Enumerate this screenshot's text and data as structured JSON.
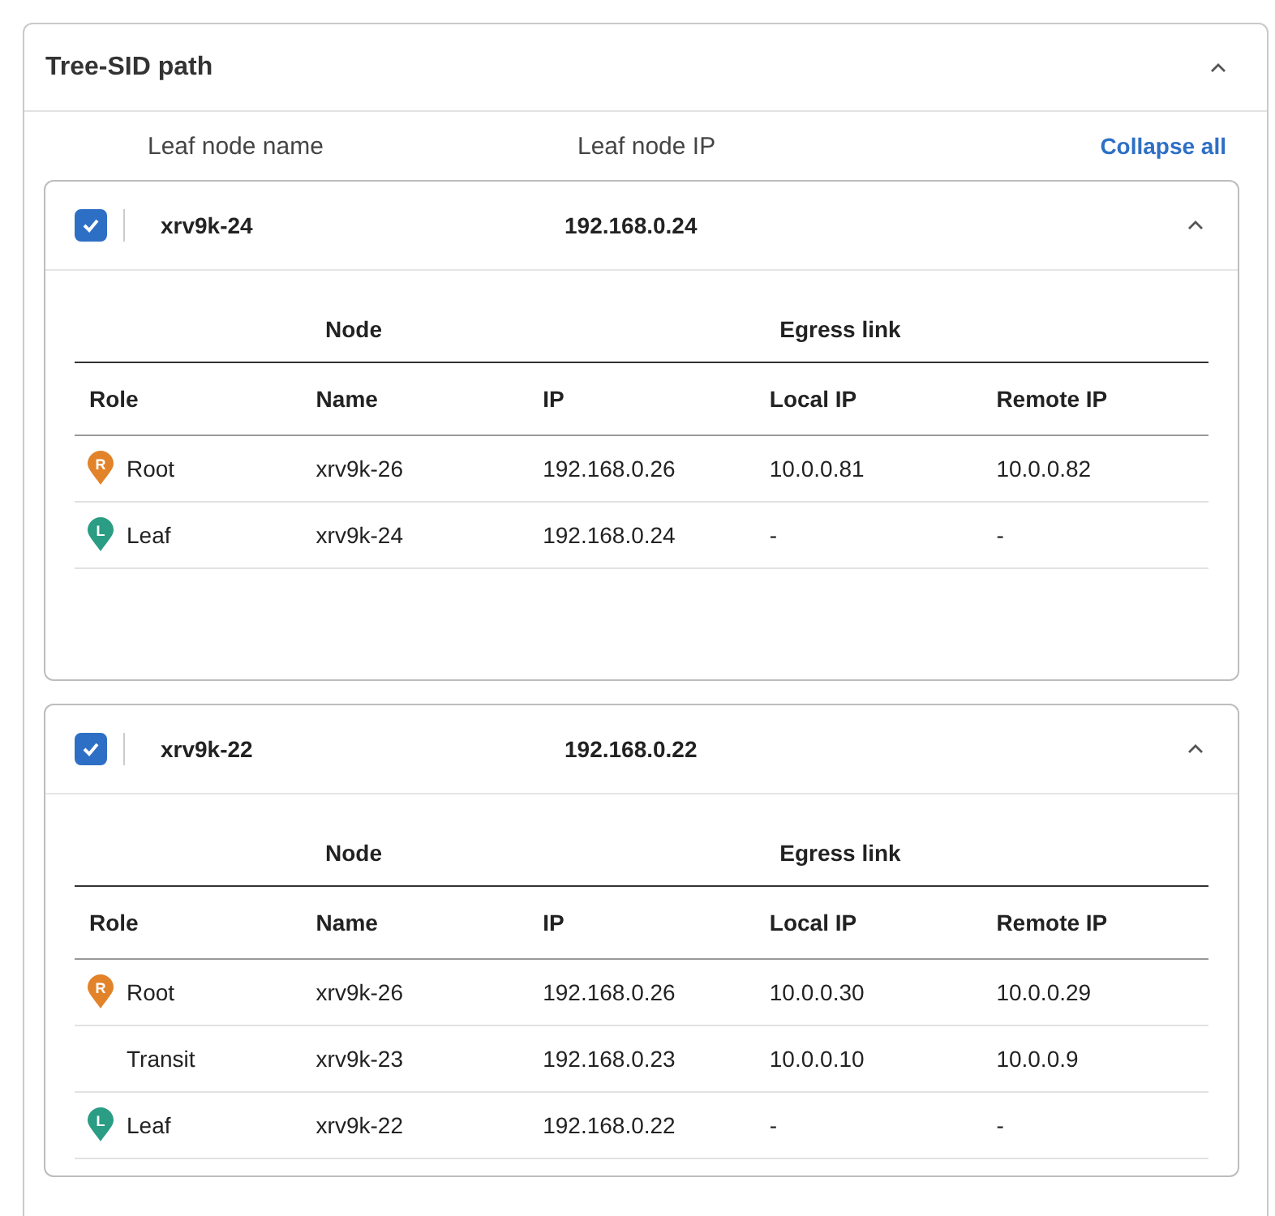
{
  "panel": {
    "title": "Tree-SID path",
    "expanded": true
  },
  "list_header": {
    "name_label": "Leaf node name",
    "ip_label": "Leaf node IP",
    "collapse_link": "Collapse all"
  },
  "leaves": [
    {
      "name": "xrv9k-24",
      "ip": "192.168.0.24",
      "checked": true,
      "expanded": true,
      "group_headers": [
        "Node",
        "Egress link"
      ],
      "columns": [
        "Role",
        "Name",
        "IP",
        "Local IP",
        "Remote IP"
      ],
      "rows": [
        {
          "kind": "root",
          "badge": "R",
          "role": "Root",
          "name": "xrv9k-26",
          "ip": "192.168.0.26",
          "local_ip": "10.0.0.81",
          "remote_ip": "10.0.0.82"
        },
        {
          "kind": "leaf",
          "badge": "L",
          "role": "Leaf",
          "name": "xrv9k-24",
          "ip": "192.168.0.24",
          "local_ip": "-",
          "remote_ip": "-"
        }
      ]
    },
    {
      "name": "xrv9k-22",
      "ip": "192.168.0.22",
      "checked": true,
      "expanded": true,
      "group_headers": [
        "Node",
        "Egress link"
      ],
      "columns": [
        "Role",
        "Name",
        "IP",
        "Local IP",
        "Remote IP"
      ],
      "rows": [
        {
          "kind": "root",
          "badge": "R",
          "role": "Root",
          "name": "xrv9k-26",
          "ip": "192.168.0.26",
          "local_ip": "10.0.0.30",
          "remote_ip": "10.0.0.29"
        },
        {
          "kind": "transit",
          "role": "Transit",
          "name": "xrv9k-23",
          "ip": "192.168.0.23",
          "local_ip": "10.0.0.10",
          "remote_ip": "10.0.0.9"
        },
        {
          "kind": "leaf",
          "badge": "L",
          "role": "Leaf",
          "name": "xrv9k-22",
          "ip": "192.168.0.22",
          "local_ip": "-",
          "remote_ip": "-"
        }
      ]
    }
  ]
}
